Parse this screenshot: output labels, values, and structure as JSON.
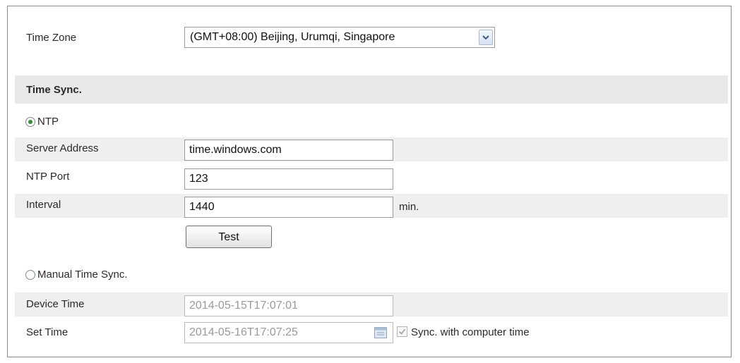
{
  "time_zone": {
    "label": "Time Zone",
    "selected": "(GMT+08:00) Beijing, Urumqi, Singapore"
  },
  "time_sync": {
    "section_title": "Time Sync.",
    "ntp": {
      "radio_label": "NTP",
      "selected": true,
      "server_address_label": "Server Address",
      "server_address_value": "time.windows.com",
      "port_label": "NTP Port",
      "port_value": "123",
      "interval_label": "Interval",
      "interval_value": "1440",
      "interval_unit": "min.",
      "test_button": "Test"
    },
    "manual": {
      "radio_label": "Manual Time Sync.",
      "selected": false,
      "device_time_label": "Device Time",
      "device_time_value": "2014-05-15T17:07:01",
      "set_time_label": "Set Time",
      "set_time_value": "2014-05-16T17:07:25",
      "sync_checkbox_label": "Sync. with computer time",
      "sync_checked": true
    }
  },
  "icons": [
    "chevron-down-icon",
    "calendar-icon",
    "checkmark-icon"
  ],
  "colors": {
    "section_bar": "#e9e9e9",
    "row_stripe": "#efefef",
    "radio_dot": "#3a8a3a",
    "disabled_text": "#9a9a9a"
  }
}
